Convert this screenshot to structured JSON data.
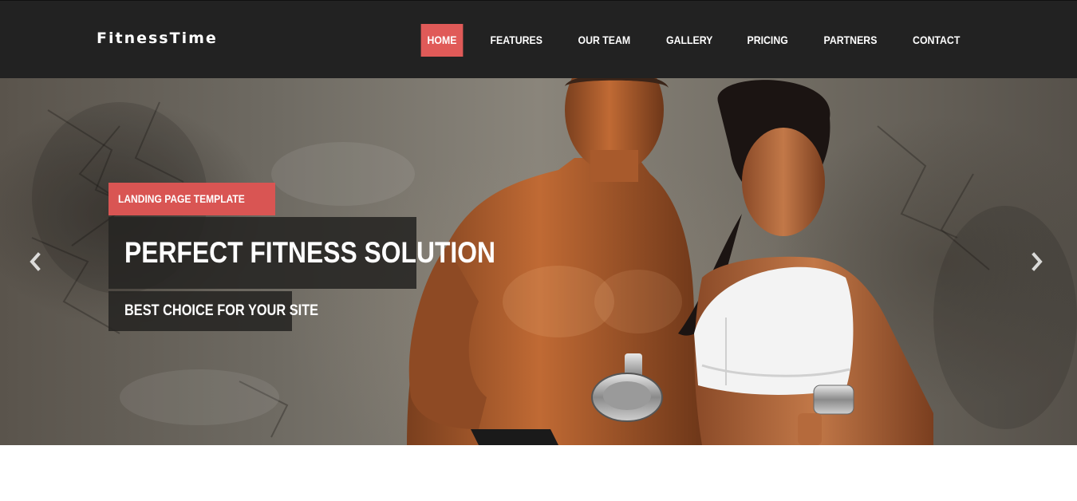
{
  "brand": "FitnessTime",
  "nav": {
    "items": [
      {
        "label": "HOME",
        "active": true
      },
      {
        "label": "FEATURES",
        "active": false
      },
      {
        "label": "OUR TEAM",
        "active": false
      },
      {
        "label": "GALLERY",
        "active": false
      },
      {
        "label": "PRICING",
        "active": false
      },
      {
        "label": "PARTNERS",
        "active": false
      },
      {
        "label": "CONTACT",
        "active": false
      }
    ]
  },
  "hero": {
    "tag": "LANDING PAGE TEMPLATE",
    "title": "PERFECT FITNESS SOLUTION",
    "subtitle": "BEST CHOICE FOR YOUR SITE",
    "prev_icon": "chevron-left-icon",
    "next_icon": "chevron-right-icon"
  },
  "colors": {
    "navbar_bg": "#222222",
    "accent": "#e05a58",
    "caption_bg": "#262422"
  }
}
